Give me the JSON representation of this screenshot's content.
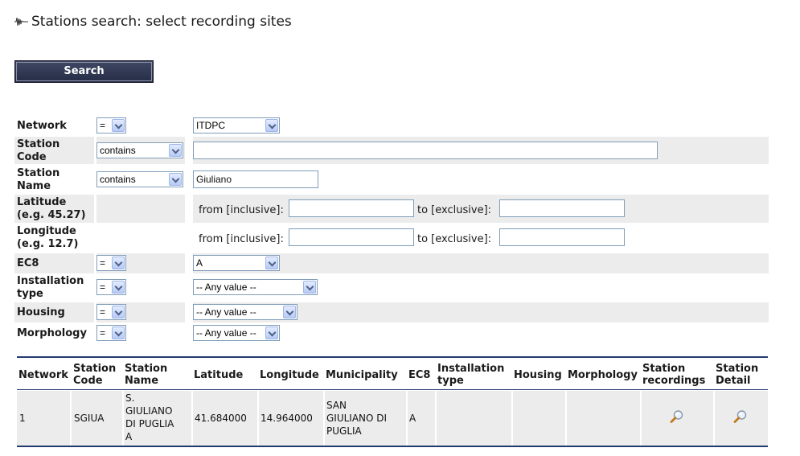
{
  "page": {
    "title": "Stations search: select recording sites",
    "title_icon": "waveform-icon"
  },
  "search_button": {
    "label": "Search"
  },
  "filters": {
    "network": {
      "label": "Network",
      "operator": "=",
      "value": "ITDPC"
    },
    "station_code": {
      "label_line1": "Station",
      "label_line2": "Code",
      "operator": "contains",
      "value": ""
    },
    "station_name": {
      "label_line1": "Station",
      "label_line2": "Name",
      "operator": "contains",
      "value": "Giuliano"
    },
    "latitude": {
      "label_line1": "Latitude",
      "label_line2": "(e.g. 45.27)",
      "from_label": "from [inclusive]:",
      "to_label": "to [exclusive]:",
      "from_value": "",
      "to_value": ""
    },
    "longitude": {
      "label_line1": "Longitude",
      "label_line2": "(e.g. 12.7)",
      "from_label": "from [inclusive]:",
      "to_label": "to [exclusive]:",
      "from_value": "",
      "to_value": ""
    },
    "ec8": {
      "label": "EC8",
      "operator": "=",
      "value": "A"
    },
    "installation_type": {
      "label_line1": "Installation",
      "label_line2": "type",
      "operator": "=",
      "value": "-- Any value --"
    },
    "housing": {
      "label": "Housing",
      "operator": "=",
      "value": "-- Any value --"
    },
    "morphology": {
      "label": "Morphology",
      "operator": "=",
      "value": "-- Any value --"
    }
  },
  "results": {
    "headers": {
      "network": "Network",
      "station_code_1": "Station",
      "station_code_2": "Code",
      "station_name_1": "Station",
      "station_name_2": "Name",
      "latitude": "Latitude",
      "longitude": "Longitude",
      "municipality": "Municipality",
      "ec8": "EC8",
      "installation_type_1": "Installation",
      "installation_type_2": "type",
      "housing": "Housing",
      "morphology": "Morphology",
      "station_recordings_1": "Station",
      "station_recordings_2": "recordings",
      "station_detail_1": "Station",
      "station_detail_2": "Detail"
    },
    "rows": [
      {
        "network": "1",
        "station_code": "SGIUA",
        "station_name_1": "S.",
        "station_name_2": "GIULIANO",
        "station_name_3": "DI PUGLIA",
        "station_name_4": "A",
        "latitude": "41.684000",
        "longitude": "14.964000",
        "municipality_1": "SAN",
        "municipality_2": "GIULIANO DI",
        "municipality_3": "PUGLIA",
        "ec8": "A",
        "installation_type": "",
        "housing": "",
        "morphology": "",
        "recordings_icon": "magnifier-icon",
        "detail_icon": "magnifier-icon"
      }
    ]
  },
  "colors": {
    "accent": "#233a70",
    "button": "#2d3450",
    "row_shade": "#ececec"
  }
}
